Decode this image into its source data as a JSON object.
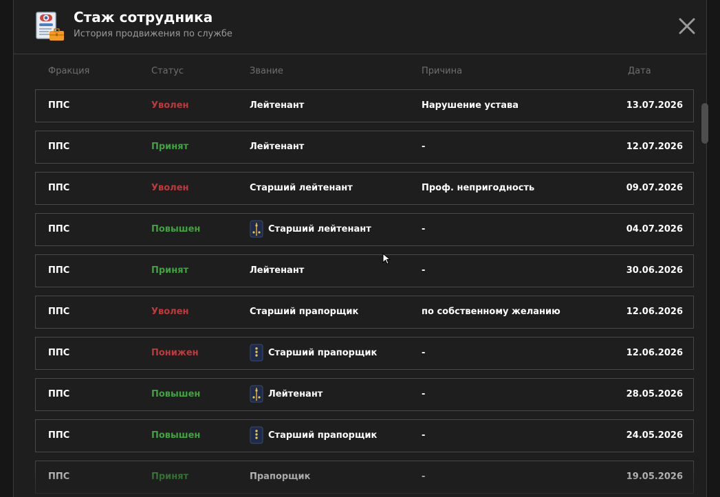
{
  "header": {
    "title": "Стаж сотрудника",
    "subtitle": "История продвижения по службе",
    "icon": "personnel-file-icon",
    "close_icon": "close-icon"
  },
  "columns": {
    "faction": "Фракция",
    "status": "Статус",
    "rank": "Звание",
    "reason": "Причина",
    "date": "Дата"
  },
  "status_colors": {
    "Уволен": "#c0393b",
    "Понижен": "#c0393b",
    "Принят": "#3fa33f",
    "Повышен": "#3fa33f"
  },
  "rows": [
    {
      "faction": "ППС",
      "status": "Уволен",
      "rank": "Лейтенант",
      "rank_icon": "",
      "reason": "Нарушение устава",
      "date": "13.07.2026"
    },
    {
      "faction": "ППС",
      "status": "Принят",
      "rank": "Лейтенант",
      "rank_icon": "",
      "reason": "-",
      "date": "12.07.2026"
    },
    {
      "faction": "ППС",
      "status": "Уволен",
      "rank": "Старший лейтенант",
      "rank_icon": "",
      "reason": "Проф. непригодность",
      "date": "09.07.2026"
    },
    {
      "faction": "ППС",
      "status": "Повышен",
      "rank": "Старший лейтенант",
      "rank_icon": "officer-shoulder-strap-icon",
      "reason": "-",
      "date": "04.07.2026"
    },
    {
      "faction": "ППС",
      "status": "Принят",
      "rank": "Лейтенант",
      "rank_icon": "",
      "reason": "-",
      "date": "30.06.2026"
    },
    {
      "faction": "ППС",
      "status": "Уволен",
      "rank": "Старший прапорщик",
      "rank_icon": "",
      "reason": "по собственному желанию",
      "date": "12.06.2026"
    },
    {
      "faction": "ППС",
      "status": "Понижен",
      "rank": "Старший прапорщик",
      "rank_icon": "warrant-shoulder-strap-icon",
      "reason": "-",
      "date": "12.06.2026"
    },
    {
      "faction": "ППС",
      "status": "Повышен",
      "rank": "Лейтенант",
      "rank_icon": "officer-shoulder-strap-icon",
      "reason": "-",
      "date": "28.05.2026"
    },
    {
      "faction": "ППС",
      "status": "Повышен",
      "rank": "Старший прапорщик",
      "rank_icon": "warrant-shoulder-strap-icon",
      "reason": "-",
      "date": "24.05.2026"
    },
    {
      "faction": "ППС",
      "status": "Принят",
      "rank": "Прапорщик",
      "rank_icon": "",
      "reason": "-",
      "date": "19.05.2026"
    }
  ]
}
